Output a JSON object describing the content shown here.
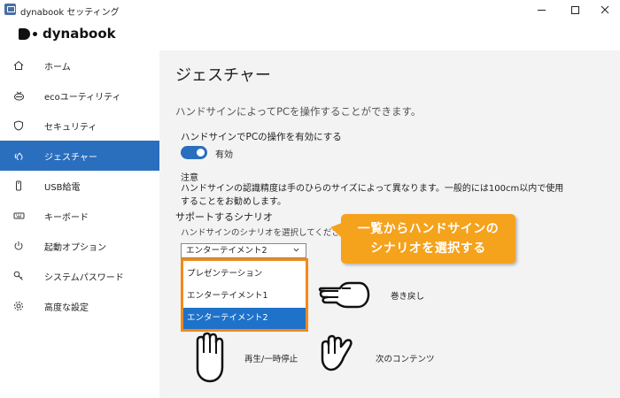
{
  "window": {
    "title": "dynabook セッティング",
    "min_icon": "minimize-icon",
    "max_icon": "maximize-icon",
    "close_icon": "close-icon"
  },
  "logo": {
    "text": "dynabook"
  },
  "sidebar": {
    "items": [
      {
        "label": "ホーム",
        "icon": "home-icon"
      },
      {
        "label": "ecoユーティリティ",
        "icon": "eco-icon"
      },
      {
        "label": "セキュリティ",
        "icon": "shield-icon"
      },
      {
        "label": "ジェスチャー",
        "icon": "gesture-icon",
        "active": true
      },
      {
        "label": "USB給電",
        "icon": "usb-icon"
      },
      {
        "label": "キーボード",
        "icon": "keyboard-icon"
      },
      {
        "label": "起動オプション",
        "icon": "power-icon"
      },
      {
        "label": "システムパスワード",
        "icon": "key-icon"
      },
      {
        "label": "高度な設定",
        "icon": "gear-icon"
      }
    ]
  },
  "main": {
    "title": "ジェスチャー",
    "description": "ハンドサインによってPCを操作することができます。",
    "enable_setting": {
      "label": "ハンドサインでPCの操作を有効にする",
      "state_label": "有効",
      "value": true
    },
    "note": {
      "title": "注意",
      "body": "ハンドサインの認識精度は手のひらのサイズによって異なります。一般的には100cm以内で使用することをお勧めします。"
    },
    "scenario": {
      "title": "サポートするシナリオ",
      "description": "ハンドサインのシナリオを選択してください。",
      "selected": "エンターテイメント2",
      "options": [
        "プレゼンテーション",
        "エンターテイメント1",
        "エンターテイメント2"
      ],
      "highlighted_option": "エンターテイメント2"
    },
    "gestures": {
      "rewind": "巻き戻し",
      "play_pause": "再生/一時停止",
      "next": "次のコンテンツ"
    }
  },
  "callout": {
    "line1": "一覧からハンドサインの",
    "line2": "シナリオを選択する"
  },
  "colors": {
    "accent": "#2a6ebe",
    "selection": "#1f72c9",
    "callout": "#f5a21c",
    "outline": "#f08a1a",
    "main_bg": "#f3f3f3"
  }
}
